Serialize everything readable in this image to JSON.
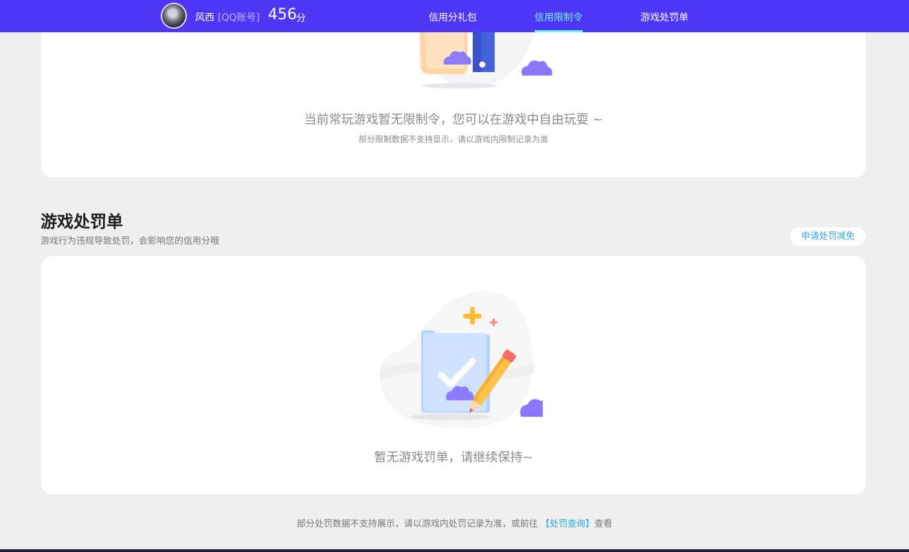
{
  "header": {
    "user_name": "风西",
    "account_type": "[QQ账号]",
    "score": "456",
    "score_unit": "分",
    "tabs": [
      {
        "label": "信用分礼包",
        "active": false
      },
      {
        "label": "信用限制令",
        "active": true
      },
      {
        "label": "游戏处罚单",
        "active": false
      }
    ]
  },
  "restriction": {
    "empty_title": "当前常玩游戏暂无限制令，您可以在游戏中自由玩耍 ~",
    "empty_note": "部分限制数据不支持显示，请以游戏内限制记录为准"
  },
  "penalty": {
    "title": "游戏处罚单",
    "subtitle": "游戏行为违规导致处罚，会影响您的信用分哦",
    "apply_label": "申请处罚减免",
    "empty_title": "暂无游戏罚单，请继续保持~"
  },
  "footer": {
    "note_prefix": "部分处罚数据不支持展示，请以游戏内处罚记录为准，或前往 ",
    "link_label": "【处罚查询】",
    "note_suffix": "查看"
  },
  "colors": {
    "header_bg": "#4f38f5",
    "active_tab": "#6ff4ff",
    "link": "#2fa9e6",
    "page_bg": "#efefef"
  }
}
